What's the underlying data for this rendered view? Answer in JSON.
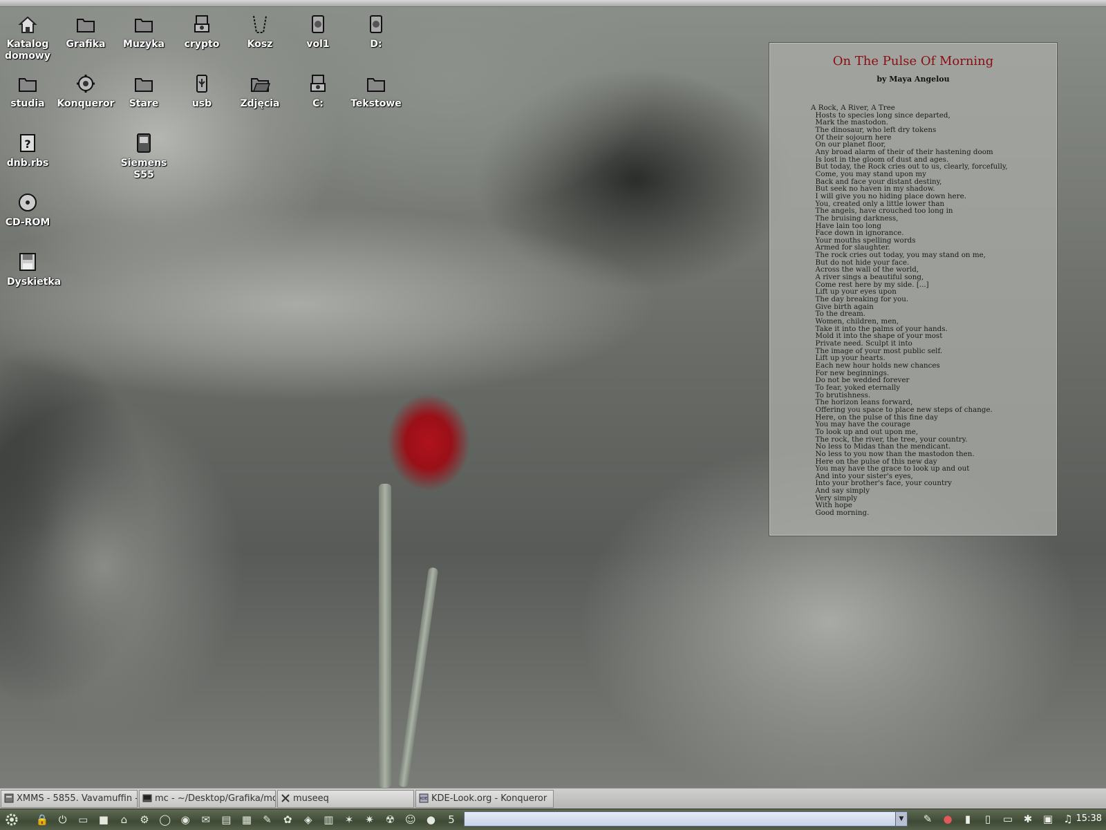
{
  "desktop_icons": [
    {
      "label": "Katalog domowy",
      "icon": "home-icon"
    },
    {
      "label": "Grafika",
      "icon": "folder-icon"
    },
    {
      "label": "Muzyka",
      "icon": "folder-icon"
    },
    {
      "label": "crypto",
      "icon": "hard-drive-icon"
    },
    {
      "label": "Kosz",
      "icon": "trash-icon"
    },
    {
      "label": "vol1",
      "icon": "drive-icon"
    },
    {
      "label": "D:",
      "icon": "drive-icon"
    },
    {
      "label": "studia",
      "icon": "folder-icon"
    },
    {
      "label": "Konqueror",
      "icon": "konqueror-icon"
    },
    {
      "label": "Stare",
      "icon": "folder-icon"
    },
    {
      "label": "usb",
      "icon": "usb-icon"
    },
    {
      "label": "Zdjęcia",
      "icon": "folder-open-icon"
    },
    {
      "label": "C:",
      "icon": "hard-drive-icon"
    },
    {
      "label": "Tekstowe",
      "icon": "folder-icon"
    },
    {
      "label": "dnb.rbs",
      "icon": "unknown-file-icon"
    },
    {
      "label": "Siemens S55",
      "icon": "phone-icon"
    },
    {
      "label": "CD-ROM",
      "icon": "cdrom-icon"
    },
    {
      "label": "Dyskietka",
      "icon": "floppy-icon"
    }
  ],
  "poem": {
    "title": "On The Pulse Of Morning",
    "author": "by Maya Angelou",
    "lines": [
      "A Rock, A River, A Tree",
      "  Hosts to species long since departed,",
      "  Mark the mastodon.",
      "  The dinosaur, who left dry tokens",
      "  Of their sojourn here",
      "  On our planet floor,",
      "  Any broad alarm of their of their hastening doom",
      "  Is lost in the gloom of dust and ages.",
      "  But today, the Rock cries out to us, clearly, forcefully,",
      "  Come, you may stand upon my",
      "  Back and face your distant destiny,",
      "  But seek no haven in my shadow.",
      "  I will give you no hiding place down here.",
      "  You, created only a little lower than",
      "  The angels, have crouched too long in",
      "  The bruising darkness,",
      "  Have lain too long",
      "  Face down in ignorance.",
      "  Your mouths spelling words",
      "  Armed for slaughter.",
      "  The rock cries out today, you may stand on me,",
      "  But do not hide your face.",
      "  Across the wall of the world,",
      "  A river sings a beautiful song,",
      "  Come rest here by my side. [...]",
      "  Lift up your eyes upon",
      "  The day breaking for you.",
      "  Give birth again",
      "  To the dream.",
      "  Women, children, men,",
      "  Take it into the palms of your hands.",
      "  Mold it into the shape of your most",
      "  Private need. Sculpt it into",
      "  The image of your most public self.",
      "  Lift up your hearts.",
      "  Each new hour holds new chances",
      "  For new beginnings.",
      "  Do not be wedded forever",
      "  To fear, yoked eternally",
      "  To brutishness.",
      "  The horizon leans forward,",
      "  Offering you space to place new steps of change.",
      "  Here, on the pulse of this fine day",
      "  You may have the courage",
      "  To look up and out upon me,",
      "  The rock, the river, the tree, your country.",
      "  No less to Midas than the mendicant.",
      "  No less to you now than the mastodon then.",
      "  Here on the pulse of this new day",
      "  You may have the grace to look up and out",
      "  And into your sister's eyes,",
      "  Into your brother's face, your country",
      "  And say simply",
      "  Very simply",
      "  With hope",
      "  Good morning."
    ]
  },
  "taskbar": {
    "tasks": [
      {
        "label": "XMMS - 5855. Vavamuffin -",
        "icon": "xmms-icon"
      },
      {
        "label": "mc - ~/Desktop/Grafika/mor",
        "icon": "terminal-icon"
      },
      {
        "label": "museeq",
        "icon": "x-window-icon"
      },
      {
        "label": "KDE-Look.org - Konqueror",
        "icon": "kde-icon"
      }
    ]
  },
  "panel": {
    "kmenu_icon": "kde-gear-icon",
    "quicklaunch": [
      "lock-icon",
      "logout-icon",
      "show-desktop-icon",
      "terminal-icon",
      "home-icon",
      "konqueror-icon",
      "opera-icon",
      "firefox-icon",
      "mail-icon",
      "settings-icon",
      "calendar-icon",
      "editor-icon",
      "paint-icon",
      "network-icon",
      "archive-icon",
      "tools-icon",
      "irc-icon",
      "radiation-icon",
      "smiley-icon",
      "user-icon",
      "html-icon"
    ],
    "command_value": "",
    "tray_icons": [
      "pen-icon",
      "record-icon",
      "volume-icon",
      "speaker-icon",
      "clipboard-icon",
      "bluetooth-icon",
      "network-tray-icon",
      "music-note-icon"
    ],
    "clock": "15:38"
  },
  "colors": {
    "poem_title": "#8b0d14",
    "panel_bg": "#4a5640",
    "taskbar_bg": "#c4c5c2"
  }
}
